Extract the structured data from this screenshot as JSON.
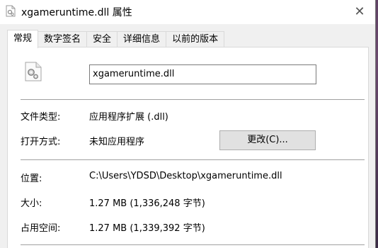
{
  "window": {
    "title": "xgameruntime.dll 属性",
    "close_glyph": "✕"
  },
  "tabs": [
    {
      "label": "常规",
      "active": true
    },
    {
      "label": "数字签名",
      "active": false
    },
    {
      "label": "安全",
      "active": false
    },
    {
      "label": "详细信息",
      "active": false
    },
    {
      "label": "以前的版本",
      "active": false
    }
  ],
  "general": {
    "file_name": "xgameruntime.dll",
    "file_type_label": "文件类型:",
    "file_type_value": "应用程序扩展 (.dll)",
    "opens_with_label": "打开方式:",
    "opens_with_value": "未知应用程序",
    "change_button": "更改(C)...",
    "location_label": "位置:",
    "location_value": "C:\\Users\\YDSD\\Desktop\\xgameruntime.dll",
    "size_label": "大小:",
    "size_value": "1.27 MB (1,336,248 字节)",
    "size_on_disk_label": "占用空间:",
    "size_on_disk_value": "1.27 MB (1,339,392 字节)"
  }
}
